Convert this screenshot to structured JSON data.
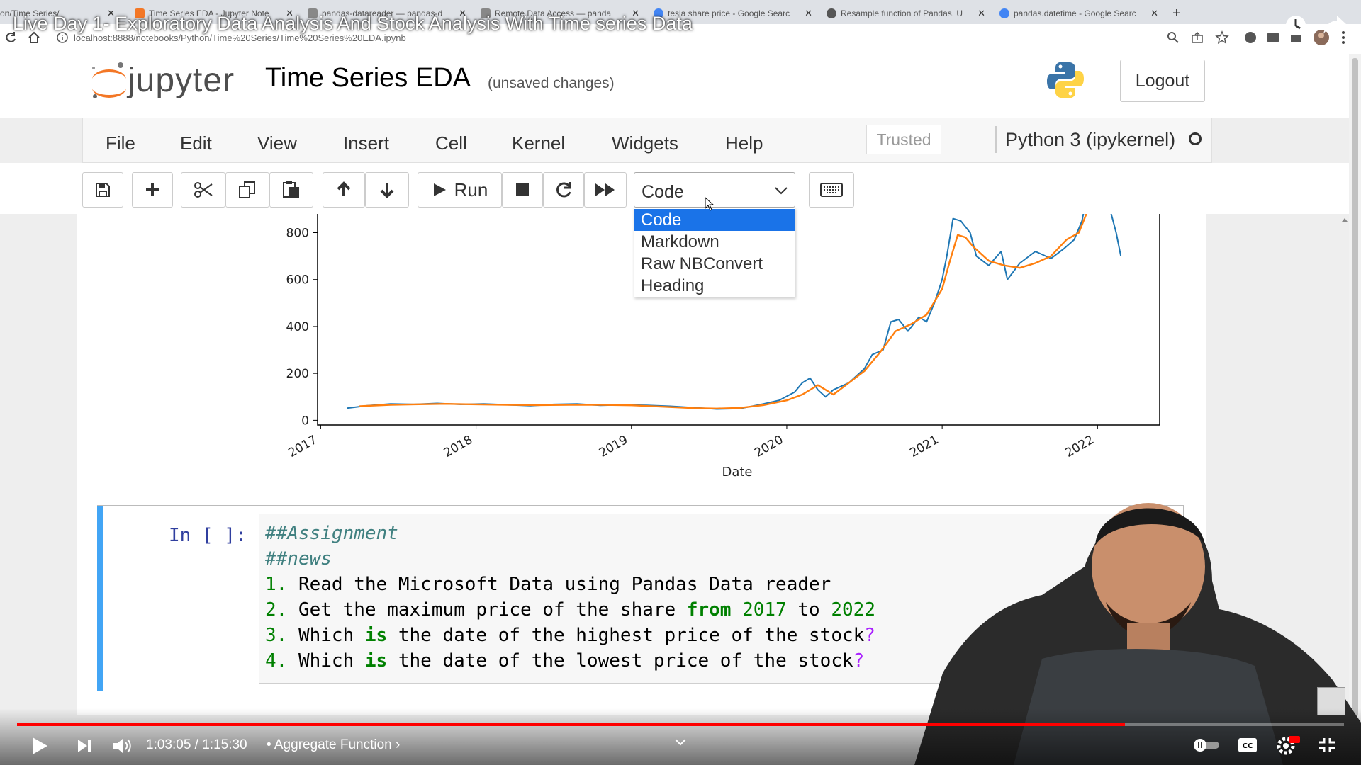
{
  "browser": {
    "tabs": [
      {
        "label": "on/Time Series/"
      },
      {
        "label": "Time Series EDA - Jupyter Note"
      },
      {
        "label": "pandas-datareader — pandas-d"
      },
      {
        "label": "Remote Data Access — panda"
      },
      {
        "label": "tesla share price - Google Searc"
      },
      {
        "label": "Resample function of Pandas. U"
      },
      {
        "label": "pandas.datetime - Google Searc"
      }
    ],
    "url": "localhost:8888/notebooks/Python/Time%20Series/Time%20Series%20EDA.ipynb"
  },
  "video": {
    "title": "Live Day 1- Exploratory Data Analysis And Stock Analysis With Time series Data",
    "time": "1:03:05 / 1:15:30",
    "chapter": "• Aggregate Function ›",
    "progress": 0.835
  },
  "notebook": {
    "logo_text": "jupyter",
    "title": "Time Series EDA",
    "status": "(unsaved changes)",
    "logout": "Logout",
    "trusted": "Trusted",
    "kernel": "Python 3 (ipykernel)",
    "menu": [
      "File",
      "Edit",
      "View",
      "Insert",
      "Cell",
      "Kernel",
      "Widgets",
      "Help"
    ],
    "toolbar": {
      "run_label": "Run",
      "cell_type": "Code",
      "cell_type_options": [
        "Code",
        "Markdown",
        "Raw NBConvert",
        "Heading"
      ]
    },
    "cell": {
      "prompt": "In [ ]:",
      "lines": [
        {
          "parts": [
            {
              "t": "##Assignment",
              "c": "cm-comment"
            }
          ]
        },
        {
          "parts": [
            {
              "t": "##news",
              "c": "cm-comment"
            }
          ]
        },
        {
          "parts": [
            {
              "t": "1.",
              "c": "cm-num"
            },
            {
              "t": " Read the Microsoft Data using Pandas Data reader",
              "c": ""
            }
          ]
        },
        {
          "parts": [
            {
              "t": "2.",
              "c": "cm-num"
            },
            {
              "t": " Get the maximum price of the share ",
              "c": ""
            },
            {
              "t": "from",
              "c": "cm-kw"
            },
            {
              "t": " ",
              "c": ""
            },
            {
              "t": "2017",
              "c": "cm-year"
            },
            {
              "t": " to ",
              "c": ""
            },
            {
              "t": "2022",
              "c": "cm-year"
            }
          ]
        },
        {
          "parts": [
            {
              "t": "3.",
              "c": "cm-num"
            },
            {
              "t": " Which ",
              "c": ""
            },
            {
              "t": "is",
              "c": "cm-kw"
            },
            {
              "t": " the date of the highest price of the stock",
              "c": ""
            },
            {
              "t": "?",
              "c": "cm-op"
            }
          ]
        },
        {
          "parts": [
            {
              "t": "4.",
              "c": "cm-num"
            },
            {
              "t": " Which ",
              "c": ""
            },
            {
              "t": "is",
              "c": "cm-kw"
            },
            {
              "t": " the date of the lowest price of the stock",
              "c": ""
            },
            {
              "t": "?",
              "c": "cm-op"
            }
          ]
        }
      ]
    }
  },
  "chart_data": {
    "type": "line",
    "xlabel": "Date",
    "ylabel": "",
    "x_ticks": [
      "2017",
      "2018",
      "2019",
      "2020",
      "2021",
      "2022"
    ],
    "y_ticks": [
      0,
      200,
      400,
      600,
      800
    ],
    "ylim": [
      -20,
      880
    ],
    "xlim": [
      2016.98,
      2022.4
    ],
    "series": [
      {
        "color": "#1f77b4",
        "x": [
          2017.17,
          2017.3,
          2017.45,
          2017.6,
          2017.75,
          2017.9,
          2018.05,
          2018.2,
          2018.35,
          2018.5,
          2018.65,
          2018.8,
          2018.95,
          2019.1,
          2019.25,
          2019.4,
          2019.55,
          2019.7,
          2019.85,
          2019.95,
          2020.05,
          2020.1,
          2020.15,
          2020.2,
          2020.25,
          2020.3,
          2020.4,
          2020.5,
          2020.55,
          2020.62,
          2020.67,
          2020.72,
          2020.78,
          2020.85,
          2020.9,
          2020.95,
          2021.0,
          2021.03,
          2021.07,
          2021.12,
          2021.18,
          2021.22,
          2021.3,
          2021.38,
          2021.42,
          2021.5,
          2021.6,
          2021.7,
          2021.78,
          2021.85,
          2021.9,
          2021.95,
          2022.0,
          2022.05,
          2022.08,
          2022.12,
          2022.15
        ],
        "y": [
          52,
          62,
          70,
          68,
          72,
          68,
          70,
          66,
          62,
          68,
          70,
          64,
          66,
          64,
          60,
          54,
          48,
          50,
          70,
          85,
          120,
          160,
          180,
          130,
          100,
          130,
          160,
          220,
          280,
          300,
          420,
          430,
          380,
          440,
          420,
          500,
          600,
          700,
          860,
          850,
          800,
          700,
          660,
          720,
          600,
          670,
          720,
          690,
          730,
          770,
          850,
          1020,
          1100,
          1000,
          900,
          800,
          700
        ]
      },
      {
        "color": "#ff7f0e",
        "x": [
          2017.25,
          2017.45,
          2017.6,
          2017.8,
          2018.0,
          2018.2,
          2018.4,
          2018.6,
          2018.8,
          2019.0,
          2019.2,
          2019.4,
          2019.55,
          2019.7,
          2019.85,
          2020.0,
          2020.1,
          2020.2,
          2020.3,
          2020.4,
          2020.5,
          2020.6,
          2020.7,
          2020.8,
          2020.9,
          2021.0,
          2021.05,
          2021.1,
          2021.15,
          2021.2,
          2021.3,
          2021.4,
          2021.5,
          2021.6,
          2021.7,
          2021.8,
          2021.88,
          2021.94
        ],
        "y": [
          60,
          66,
          68,
          70,
          68,
          66,
          65,
          66,
          66,
          64,
          58,
          52,
          50,
          53,
          65,
          85,
          110,
          150,
          110,
          160,
          210,
          290,
          380,
          410,
          450,
          560,
          680,
          790,
          780,
          740,
          680,
          660,
          650,
          670,
          700,
          770,
          800,
          900
        ]
      }
    ]
  }
}
